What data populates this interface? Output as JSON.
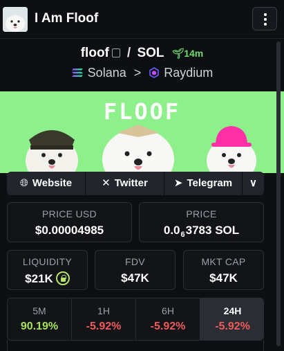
{
  "header": {
    "title": "I Am Floof",
    "menu_icon": "kebab-menu-icon"
  },
  "token": {
    "symbol": "floof",
    "separator": "/",
    "quote": "SOL",
    "age": "14m",
    "age_icon": "sprout-icon",
    "age_color": "#6fdc6f"
  },
  "chain": {
    "name": "Solana",
    "dex": "Raydium"
  },
  "banner": {
    "title": "FLOOF",
    "background": "#8ef08a"
  },
  "socials": [
    {
      "label": "Website",
      "icon": "globe-icon"
    },
    {
      "label": "Twitter",
      "icon": "x-logo-icon"
    },
    {
      "label": "Telegram",
      "icon": "telegram-icon"
    }
  ],
  "price_usd": {
    "label": "PRICE USD",
    "value": "$0.00004985"
  },
  "price_native": {
    "label": "PRICE",
    "prefix": "0.0",
    "zeros": "6",
    "digits": "3783",
    "unit": "SOL"
  },
  "liquidity": {
    "label": "LIQUIDITY",
    "value": "$21K",
    "badge_icon": "lock-icon"
  },
  "fdv": {
    "label": "FDV",
    "value": "$47K"
  },
  "mkt_cap": {
    "label": "MKT CAP",
    "value": "$47K"
  },
  "timeframes": [
    {
      "label": "5M",
      "change": "90.19%",
      "color": "#a6e25a"
    },
    {
      "label": "1H",
      "change": "-5.92%",
      "color": "#f05a5a"
    },
    {
      "label": "6H",
      "change": "-5.92%",
      "color": "#f05a5a"
    },
    {
      "label": "24H",
      "change": "-5.92%",
      "color": "#f05a5a",
      "active": true
    }
  ]
}
